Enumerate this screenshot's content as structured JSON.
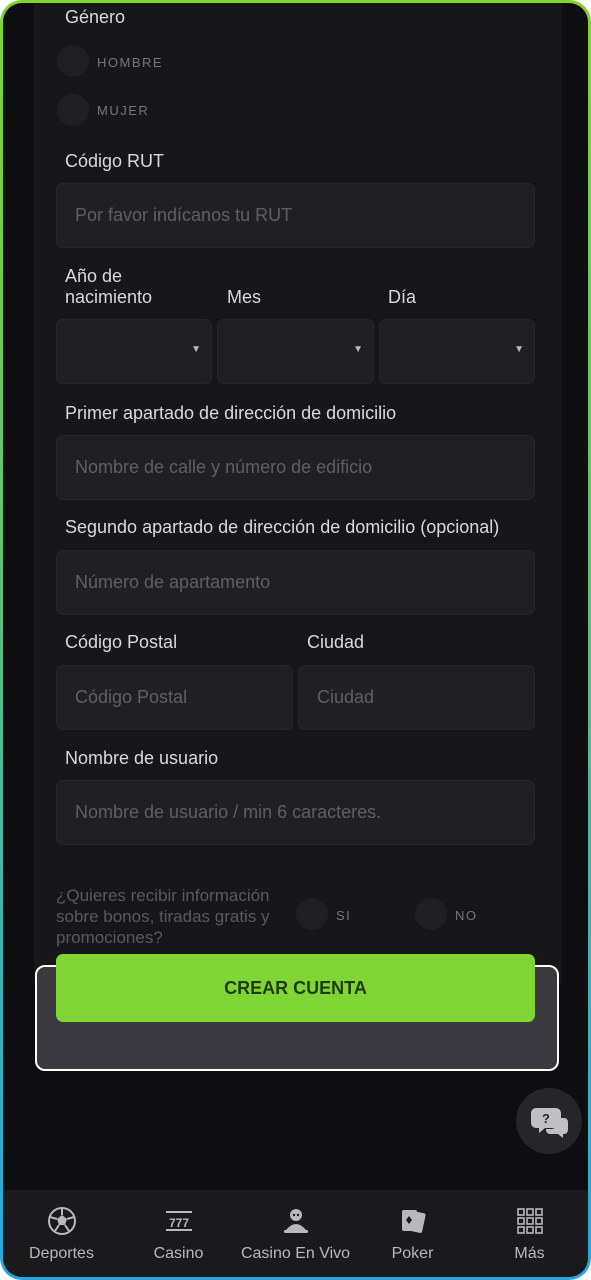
{
  "form": {
    "gender": {
      "label": "Género",
      "options": [
        "HOMBRE",
        "MUJER"
      ]
    },
    "rut": {
      "label": "Código RUT",
      "placeholder": "Por favor indícanos tu RUT"
    },
    "birth": {
      "year_label": "Año de nacimiento",
      "year_label_line1": "Año de",
      "year_label_line2": "nacimiento",
      "month_label": "Mes",
      "day_label": "Día"
    },
    "address1": {
      "label": "Primer apartado de dirección de domicilio",
      "placeholder": "Nombre de calle y número de edificio"
    },
    "address2": {
      "label": "Segundo apartado de dirección de domicilio (opcional)",
      "placeholder": "Número de apartamento"
    },
    "postal": {
      "label": "Código Postal",
      "placeholder": "Código Postal"
    },
    "city": {
      "label": "Ciudad",
      "placeholder": "Ciudad"
    },
    "username": {
      "label": "Nombre de usuario",
      "placeholder": "Nombre de usuario / min 6 caracteres."
    },
    "promos": {
      "question": "¿Quieres recibir información sobre bonos, tiradas gratis y promociones?",
      "line1": "¿Quieres recibir información",
      "line2": "sobre bonos, tiradas gratis y",
      "line3": "promociones?",
      "yes": "SI",
      "no": "NO"
    },
    "submit_label": "CREAR CUENTA"
  },
  "chat": {
    "icon": "chat-help-icon"
  },
  "tabbar": {
    "items": [
      {
        "label": "Deportes",
        "icon": "soccer-ball-icon"
      },
      {
        "label": "Casino",
        "icon": "slot-777-icon"
      },
      {
        "label": "Casino En Vivo",
        "icon": "live-dealer-icon"
      },
      {
        "label": "Poker",
        "icon": "playing-cards-icon"
      },
      {
        "label": "Más",
        "icon": "grid-menu-icon"
      }
    ]
  },
  "colors": {
    "accent": "#7ed534",
    "background": "#0e0e10",
    "field": "#202024"
  }
}
